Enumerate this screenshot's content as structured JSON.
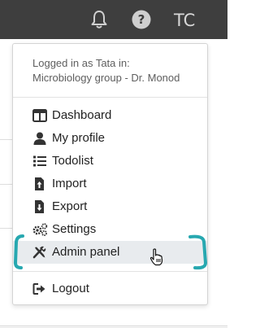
{
  "header": {
    "avatar_initials": "TC",
    "icons": [
      "bell-icon",
      "help-icon"
    ]
  },
  "dropdown": {
    "logged_in_line1": "Logged in as Tata in:",
    "logged_in_line2": "Microbiology group - Dr. Monod",
    "items": [
      {
        "label": "Dashboard",
        "icon": "dashboard-icon"
      },
      {
        "label": "My profile",
        "icon": "user-icon"
      },
      {
        "label": "Todolist",
        "icon": "list-icon"
      },
      {
        "label": "Import",
        "icon": "import-file-icon"
      },
      {
        "label": "Export",
        "icon": "export-file-icon"
      },
      {
        "label": "Settings",
        "icon": "gears-icon"
      },
      {
        "label": "Admin panel",
        "icon": "tools-icon"
      },
      {
        "label": "Logout",
        "icon": "logout-icon"
      }
    ]
  },
  "colors": {
    "topbar": "#3e3e3e",
    "highlight_bracket": "#27a8b0",
    "active_item_bg": "#e8ebee"
  }
}
